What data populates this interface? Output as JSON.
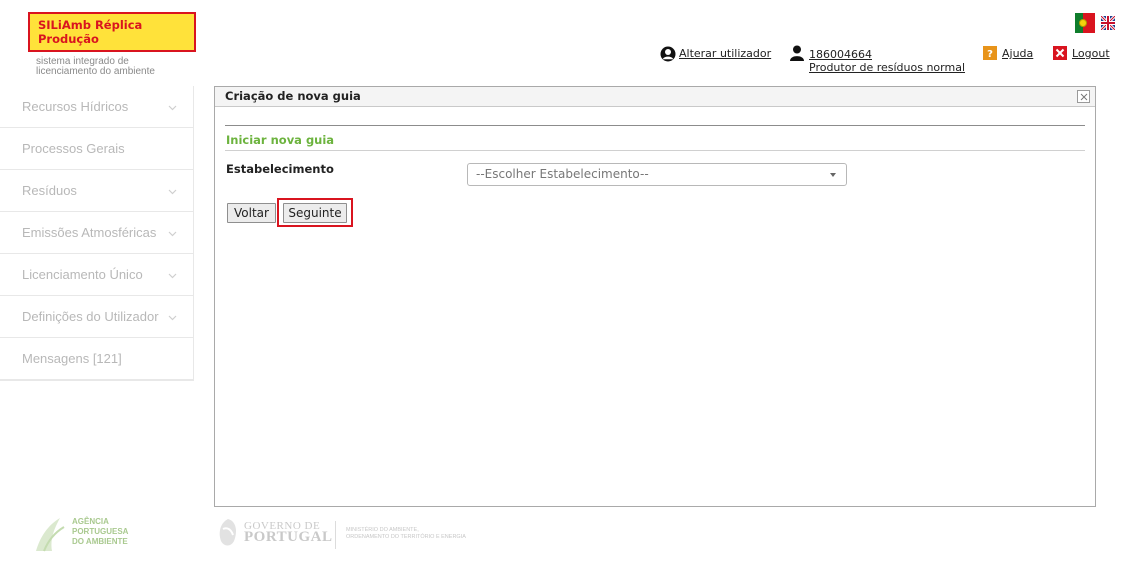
{
  "header": {
    "brand_title": "SILiAmb Réplica Produção",
    "brand_subtitle_line1": "sistema integrado de",
    "brand_subtitle_line2": "licenciamento do ambiente",
    "change_user_label": "Alterar utilizador",
    "user_id": "186004664",
    "user_role": "Produtor de resíduos normal",
    "help_label": "Ajuda",
    "logout_label": "Logout"
  },
  "sidebar": {
    "items": [
      {
        "label": "Recursos Hídricos",
        "has_chevron": true
      },
      {
        "label": "Processos Gerais",
        "has_chevron": false
      },
      {
        "label": "Resíduos",
        "has_chevron": true
      },
      {
        "label": "Emissões Atmosféricas",
        "has_chevron": true
      },
      {
        "label": "Licenciamento Único",
        "has_chevron": true
      },
      {
        "label": "Definições do Utilizador",
        "has_chevron": true
      },
      {
        "label": "Mensagens [121]",
        "has_chevron": false
      }
    ]
  },
  "panel": {
    "title": "Criação de nova guia",
    "section_title": "Iniciar nova guia",
    "field_label": "Estabelecimento",
    "select_value": "--Escolher Estabelecimento--",
    "back_label": "Voltar",
    "next_label": "Seguinte"
  },
  "footer": {
    "apa_line1": "AGÊNCIA",
    "apa_line2": "PORTUGUESA",
    "apa_line3": "DO AMBIENTE",
    "gov_line1": "GOVERNO DE",
    "gov_line2": "PORTUGAL",
    "ministry_line1": "MINISTÉRIO DO AMBIENTE,",
    "ministry_line2": "ORDENAMENTO DO TERRITÓRIO E ENERGIA"
  },
  "colors": {
    "brand_yellow": "#ffe23a",
    "brand_red": "#d9141f",
    "section_green": "#6cb33e"
  }
}
